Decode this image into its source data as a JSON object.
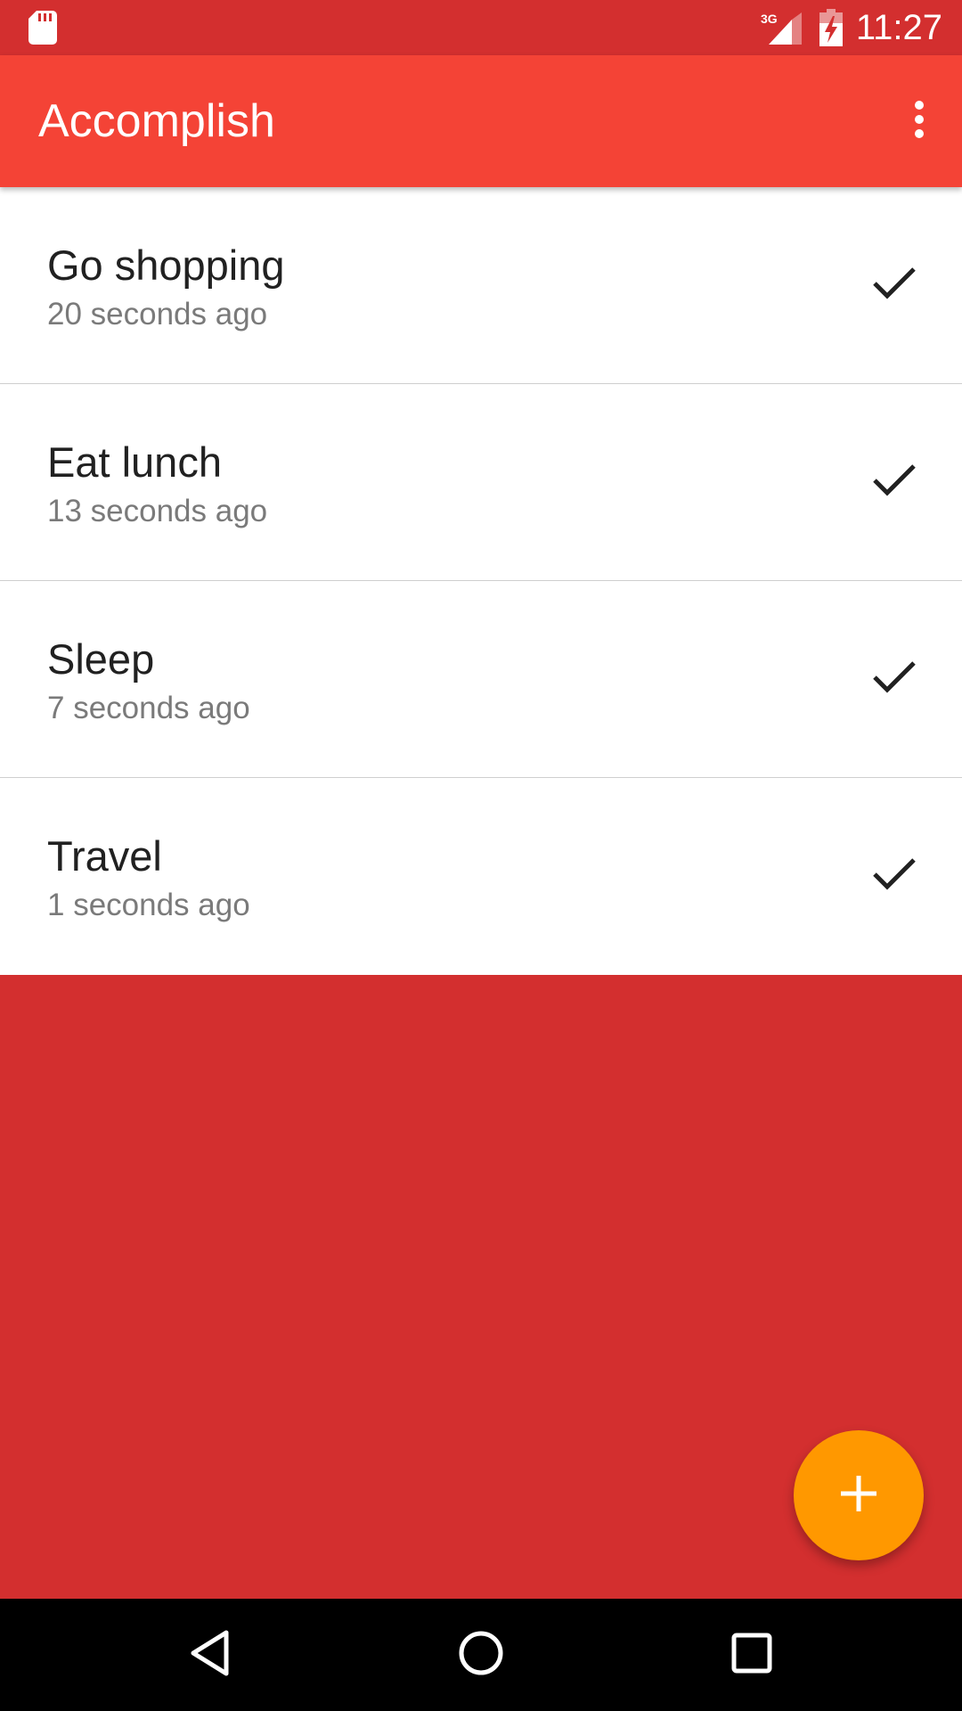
{
  "status_bar": {
    "time": "11:27",
    "network_label": "3G",
    "icons": [
      "sd-card-icon",
      "cell-signal-icon",
      "battery-charging-icon"
    ]
  },
  "app_bar": {
    "title": "Accomplish",
    "menu_icon": "more-vert-icon"
  },
  "tasks": [
    {
      "title": "Go shopping",
      "subtitle": "20 seconds ago",
      "action_icon": "check-icon"
    },
    {
      "title": "Eat lunch",
      "subtitle": "13 seconds ago",
      "action_icon": "check-icon"
    },
    {
      "title": "Sleep",
      "subtitle": "7 seconds ago",
      "action_icon": "check-icon"
    },
    {
      "title": "Travel",
      "subtitle": "1 seconds ago",
      "action_icon": "check-icon"
    }
  ],
  "fab": {
    "icon": "plus-icon",
    "color": "#ff9800"
  },
  "nav_bar": {
    "icons": [
      "back-icon",
      "home-icon",
      "recents-icon"
    ]
  },
  "colors": {
    "primary": "#f44336",
    "primary_dark": "#d32f2f",
    "accent": "#ff9800"
  }
}
